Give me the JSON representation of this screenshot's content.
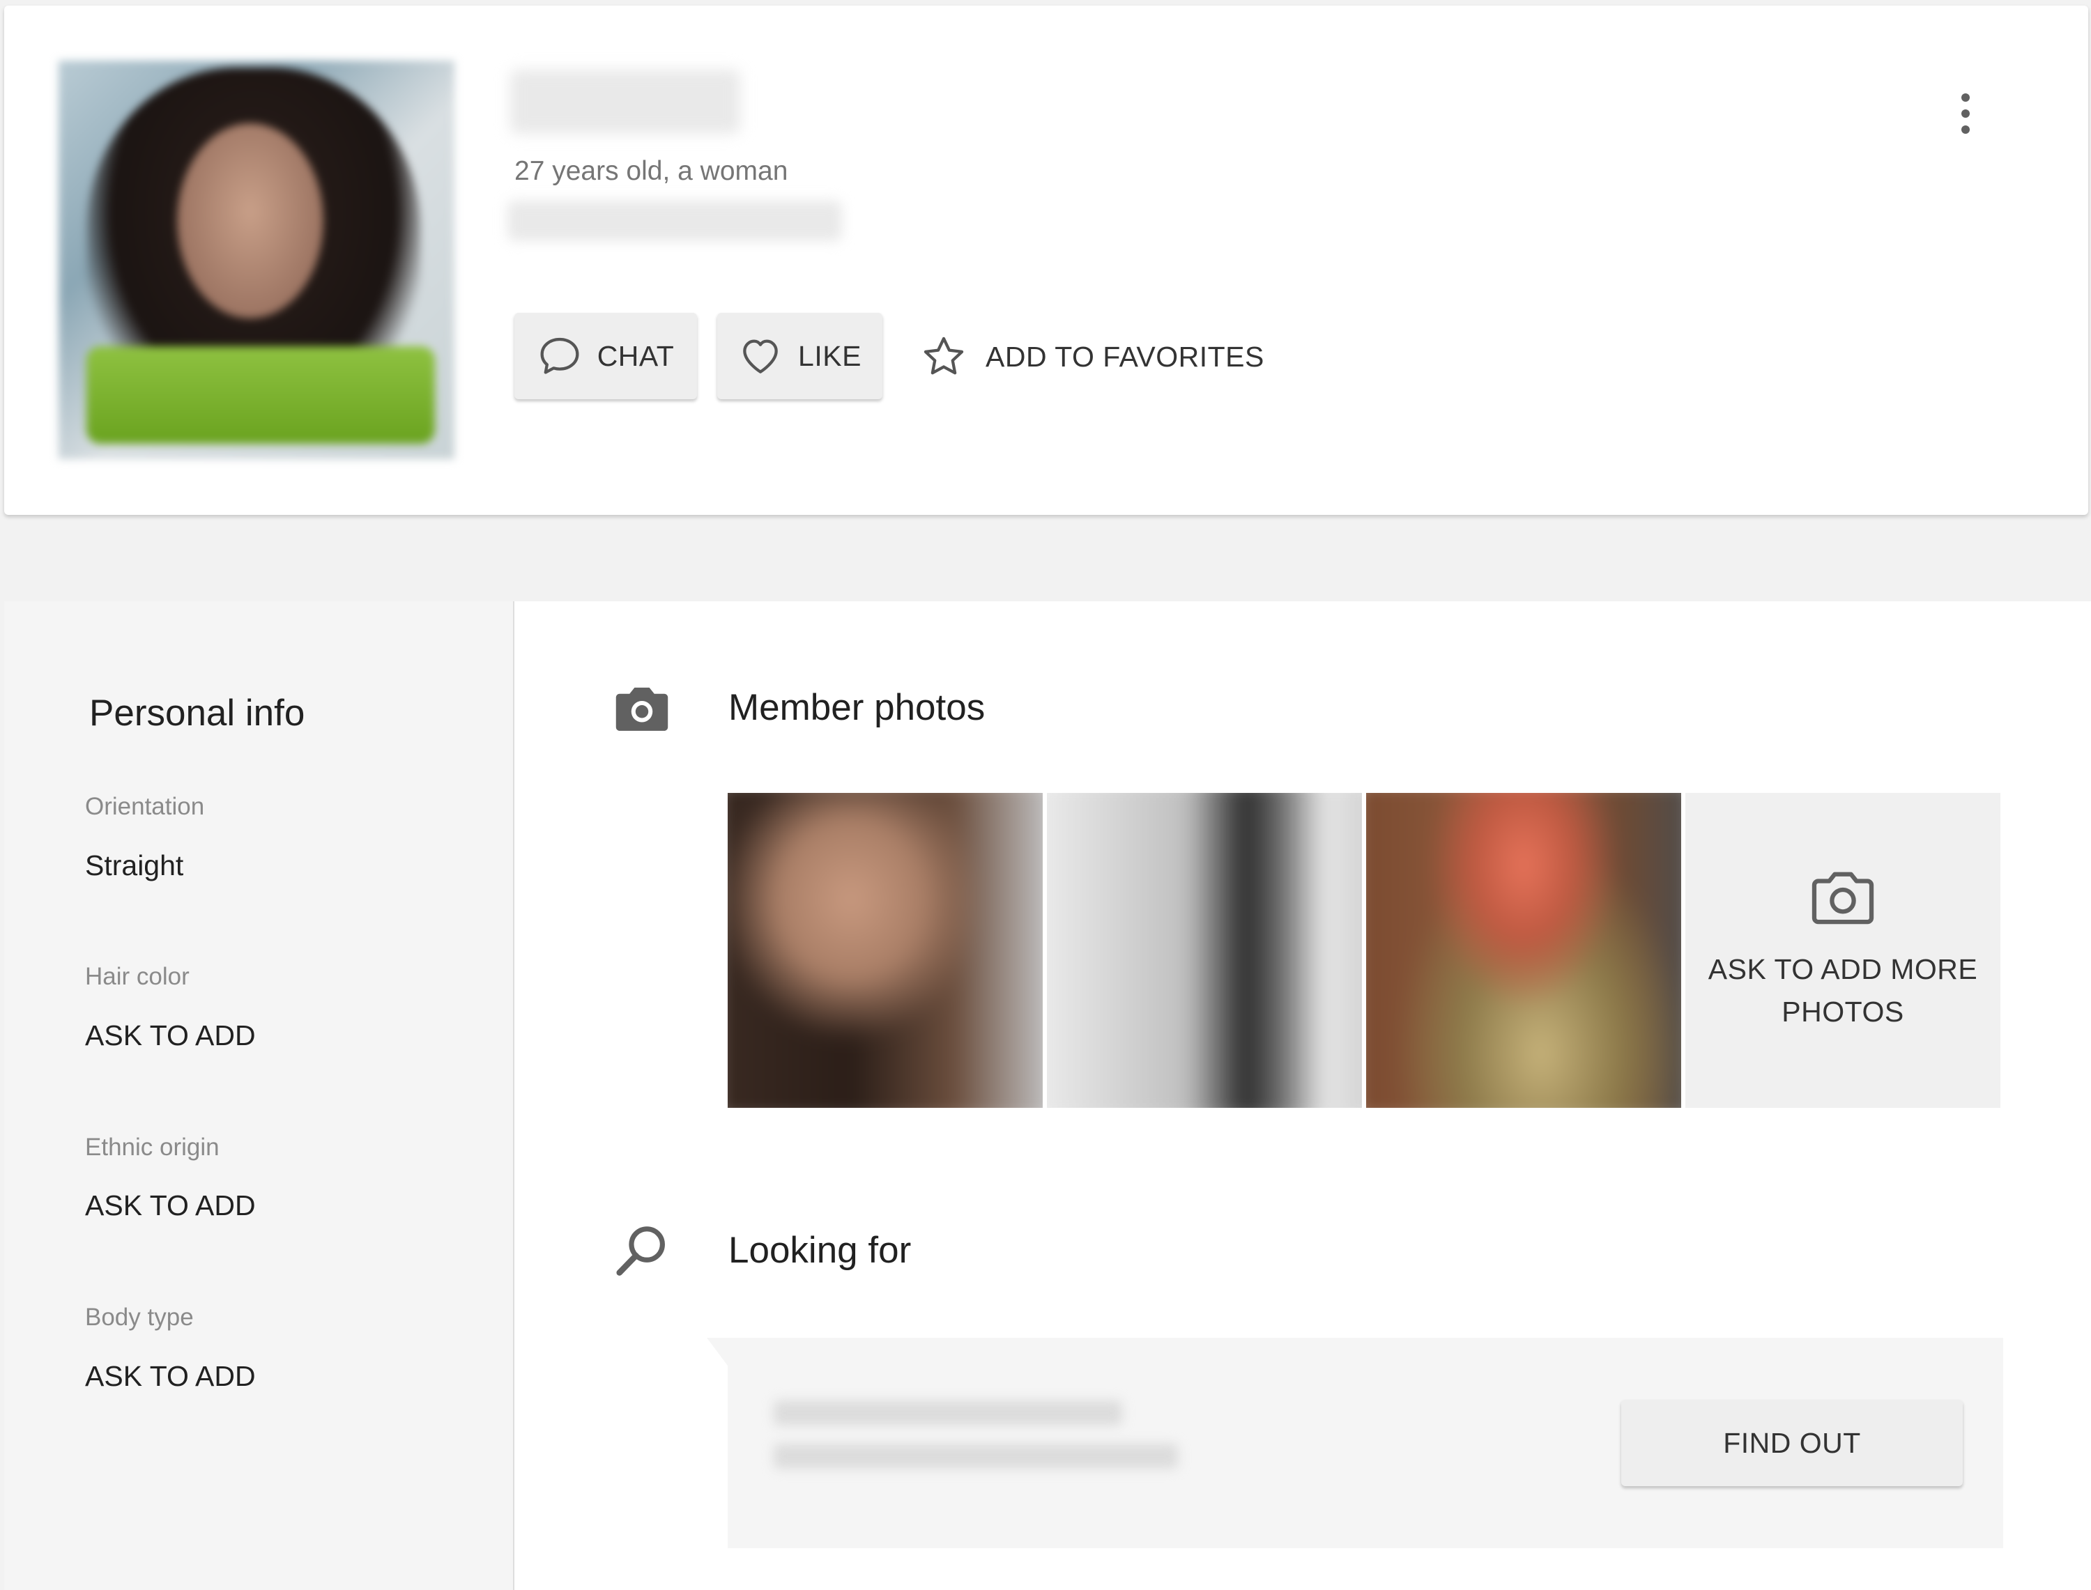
{
  "profile": {
    "subtitle": "27 years old, a woman",
    "actions": {
      "chat_label": "CHAT",
      "like_label": "LIKE",
      "favorites_label": "ADD TO FAVORITES"
    }
  },
  "personal_info": {
    "title": "Personal info",
    "fields": [
      {
        "label": "Orientation",
        "value": "Straight"
      },
      {
        "label": "Hair color",
        "value": "ASK TO ADD"
      },
      {
        "label": "Ethnic origin",
        "value": "ASK TO ADD"
      },
      {
        "label": "Body type",
        "value": "ASK TO ADD"
      }
    ]
  },
  "member_photos": {
    "title": "Member photos",
    "ask_more_label": "ASK TO ADD MORE PHOTOS"
  },
  "looking_for": {
    "title": "Looking for",
    "find_out_label": "FIND OUT"
  },
  "icons": {
    "chat": "chat-bubble-icon",
    "like": "heart-icon",
    "favorites": "star-icon",
    "menu": "more-vert-icon",
    "photos": "camera-icon",
    "looking_for": "search-icon"
  }
}
